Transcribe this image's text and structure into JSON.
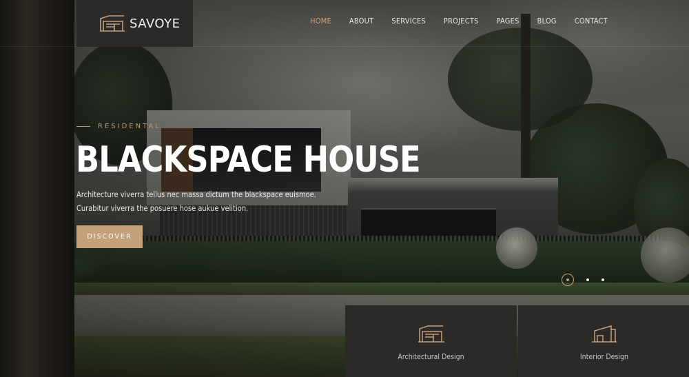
{
  "brand": {
    "name": "SAVOYE",
    "logo_icon": "savoye-building-logo-icon"
  },
  "nav": {
    "items": [
      {
        "label": "HOME",
        "active": true
      },
      {
        "label": "ABOUT",
        "active": false
      },
      {
        "label": "SERVICES",
        "active": false
      },
      {
        "label": "PROJECTS",
        "active": false
      },
      {
        "label": "PAGES",
        "active": false
      },
      {
        "label": "BLOG",
        "active": false
      },
      {
        "label": "CONTACT",
        "active": false
      }
    ]
  },
  "hero": {
    "eyebrow": "RESIDENTAL",
    "title": "BLACKSPACE HOUSE",
    "description_line1": "Architecture viverra tellus nec massa dictum the blackspace euismoe.",
    "description_line2": "Curabitur viverra the posuere hose aukue velition.",
    "cta_label": "DISCOVER"
  },
  "slider": {
    "count": 3,
    "active_index": 0
  },
  "services": [
    {
      "label": "Architectural Design",
      "icon": "architecture-building-icon"
    },
    {
      "label": "Interior Design",
      "icon": "interior-house-icon"
    }
  ],
  "colors": {
    "accent": "#c6a07a",
    "nav_active": "#c9a27c",
    "panel": "#2b2a29",
    "text_light": "#ffffff"
  }
}
